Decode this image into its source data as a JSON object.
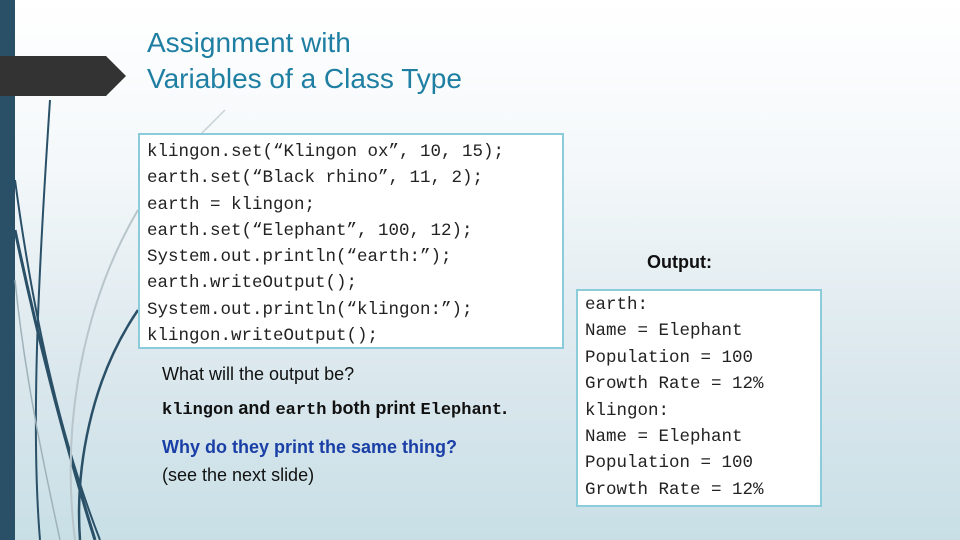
{
  "slide": {
    "title_lines": [
      "Assignment with",
      "Variables of a Class Type"
    ],
    "code_lines": [
      "klingon.set(“Klingon ox”, 10, 15);",
      "earth.set(“Black rhino”, 11, 2);",
      "earth = klingon;",
      "earth.set(“Elephant”, 100, 12);",
      "System.out.println(“earth:”);",
      "earth.writeOutput();",
      "System.out.println(“klingon:”);",
      "klingon.writeOutput();"
    ],
    "question": "What will the output be?",
    "answer": {
      "var1": "klingon",
      "and": " and ",
      "var2": "earth",
      "both_print": " both print ",
      "value": "Elephant",
      "period": "."
    },
    "why": "Why do they print the same thing?",
    "see_next": "(see the next slide)",
    "output_label": "Output:",
    "output_lines": [
      "earth:",
      "Name = Elephant",
      "Population = 100",
      "Growth Rate = 12%",
      "klingon:",
      "Name = Elephant",
      "Population = 100",
      "Growth Rate = 12%"
    ]
  },
  "colors": {
    "title": "#1f7fa3",
    "accent_bar": "#2a5068",
    "box_border": "#8ccbd9",
    "why_text": "#1a3fa6"
  }
}
